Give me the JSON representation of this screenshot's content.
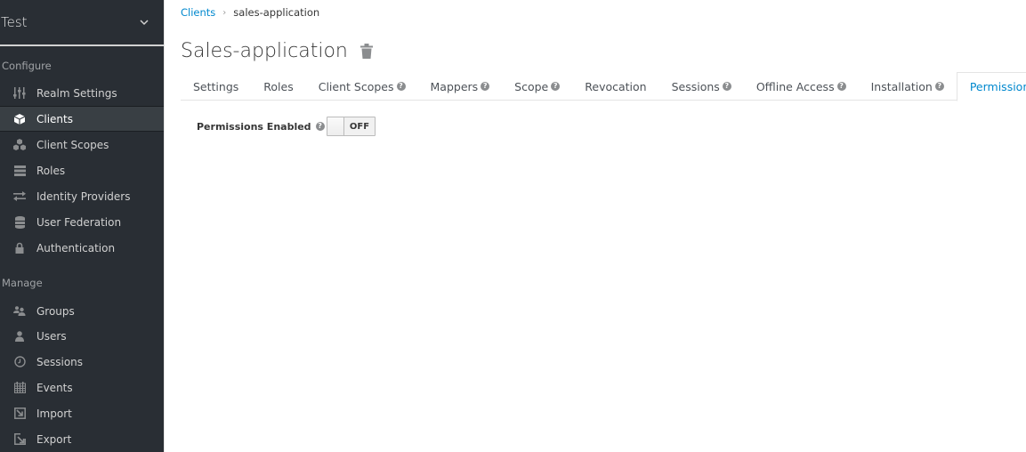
{
  "sidebar": {
    "realm": {
      "name": "Test",
      "chevron_icon": "chevron-down-icon"
    },
    "sections": [
      {
        "title": "Configure",
        "items": [
          {
            "label": "Realm Settings",
            "icon": "sliders-icon",
            "active": false
          },
          {
            "label": "Clients",
            "icon": "cube-icon",
            "active": true
          },
          {
            "label": "Client Scopes",
            "icon": "cubes-icon",
            "active": false
          },
          {
            "label": "Roles",
            "icon": "list-icon",
            "active": false
          },
          {
            "label": "Identity Providers",
            "icon": "exchange-icon",
            "active": false
          },
          {
            "label": "User Federation",
            "icon": "database-icon",
            "active": false
          },
          {
            "label": "Authentication",
            "icon": "lock-icon",
            "active": false
          }
        ]
      },
      {
        "title": "Manage",
        "items": [
          {
            "label": "Groups",
            "icon": "users-icon",
            "active": false
          },
          {
            "label": "Users",
            "icon": "user-icon",
            "active": false
          },
          {
            "label": "Sessions",
            "icon": "clock-icon",
            "active": false
          },
          {
            "label": "Events",
            "icon": "calendar-icon",
            "active": false
          },
          {
            "label": "Import",
            "icon": "import-icon",
            "active": false
          },
          {
            "label": "Export",
            "icon": "export-icon",
            "active": false
          }
        ]
      }
    ]
  },
  "breadcrumb": {
    "link": "Clients",
    "separator": "›",
    "current": "sales-application"
  },
  "page": {
    "title": "Sales-application",
    "delete_icon": "trash-icon"
  },
  "tabs": [
    {
      "label": "Settings",
      "help": false,
      "active": false
    },
    {
      "label": "Roles",
      "help": false,
      "active": false
    },
    {
      "label": "Client Scopes",
      "help": true,
      "active": false
    },
    {
      "label": "Mappers",
      "help": true,
      "active": false
    },
    {
      "label": "Scope",
      "help": true,
      "active": false
    },
    {
      "label": "Revocation",
      "help": false,
      "active": false
    },
    {
      "label": "Sessions",
      "help": true,
      "active": false
    },
    {
      "label": "Offline Access",
      "help": true,
      "active": false
    },
    {
      "label": "Installation",
      "help": true,
      "active": false
    },
    {
      "label": "Permissions",
      "help": true,
      "active": true
    }
  ],
  "form": {
    "permissions_enabled": {
      "label": "Permissions Enabled",
      "value": false,
      "toggle_text": "OFF"
    }
  },
  "help_glyph": "?",
  "colors": {
    "sidebar_bg": "#292e34",
    "sidebar_active_bg": "#393f44",
    "link": "#0088ce",
    "text": "#363636"
  }
}
